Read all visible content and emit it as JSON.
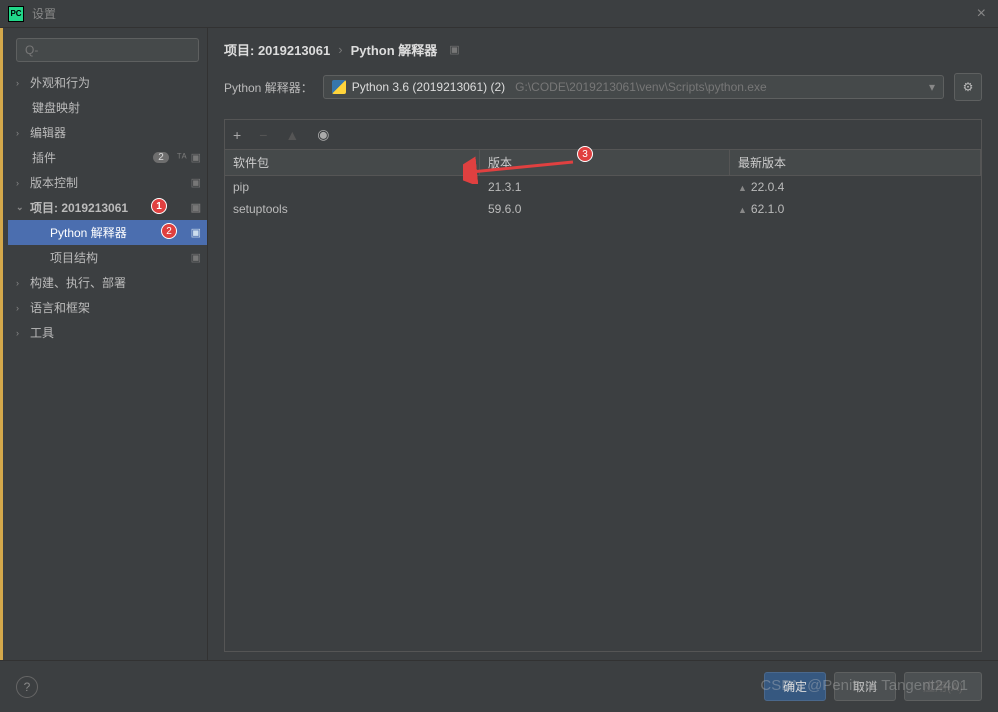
{
  "titlebar": {
    "title": "设置"
  },
  "search": {
    "placeholder": "Q-"
  },
  "sidebar": {
    "items": [
      {
        "label": "外观和行为",
        "expandable": true,
        "expanded": false
      },
      {
        "label": "键盘映射",
        "expandable": false
      },
      {
        "label": "编辑器",
        "expandable": true,
        "expanded": false
      },
      {
        "label": "插件",
        "expandable": false,
        "badge": "2"
      },
      {
        "label": "版本控制",
        "expandable": true,
        "expanded": false,
        "projicon": true
      },
      {
        "label": "项目: 2019213061",
        "expandable": true,
        "expanded": true,
        "projicon": true,
        "bold": true,
        "annotation": "1"
      },
      {
        "label": "Python 解释器",
        "sub": true,
        "selected": true,
        "projicon": true,
        "annotation": "2"
      },
      {
        "label": "项目结构",
        "sub": true,
        "projicon": true
      },
      {
        "label": "构建、执行、部署",
        "expandable": true,
        "expanded": false
      },
      {
        "label": "语言和框架",
        "expandable": true,
        "expanded": false
      },
      {
        "label": "工具",
        "expandable": true,
        "expanded": false
      }
    ]
  },
  "breadcrumb": {
    "item1": "项目: 2019213061",
    "item2": "Python 解释器"
  },
  "interpreter": {
    "label": "Python 解释器：",
    "name": "Python 3.6 (2019213061) (2)",
    "path": "G:\\CODE\\2019213061\\venv\\Scripts\\python.exe"
  },
  "packages": {
    "headers": {
      "name": "软件包",
      "version": "版本",
      "latest": "最新版本"
    },
    "rows": [
      {
        "name": "pip",
        "version": "21.3.1",
        "latest": "22.0.4"
      },
      {
        "name": "setuptools",
        "version": "59.6.0",
        "latest": "62.1.0"
      }
    ]
  },
  "annotations": {
    "arrow_badge": "3"
  },
  "footer": {
    "ok": "确定",
    "cancel": "取消",
    "apply": "应用(A)"
  },
  "watermark": "CSDN @Penitent Tangent2401"
}
